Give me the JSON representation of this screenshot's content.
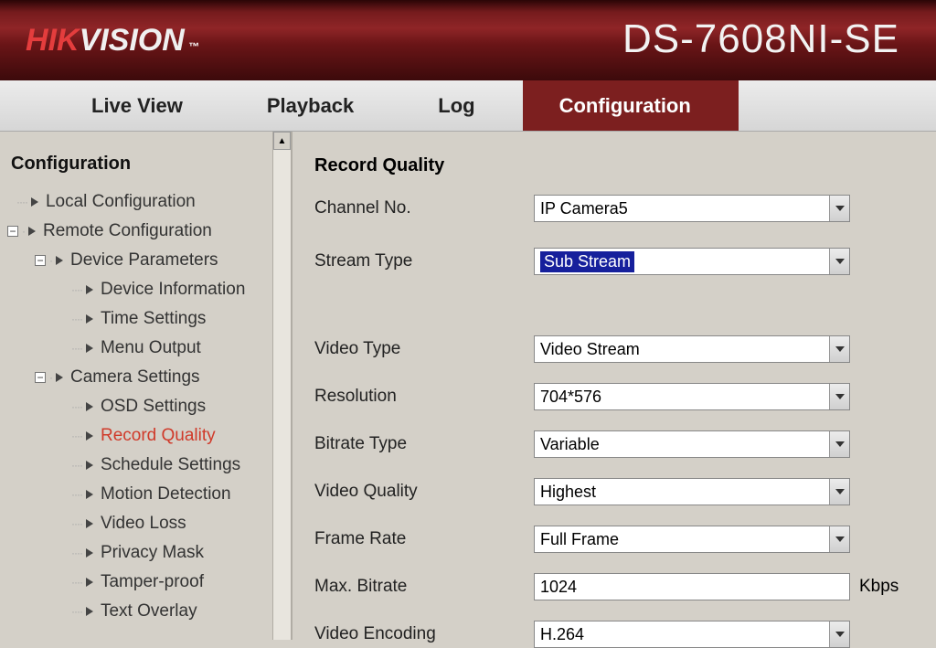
{
  "brand": {
    "hik": "HIK",
    "vision": "VISION",
    "tm": "™"
  },
  "model": "DS-7608NI-SE",
  "tabs": {
    "live_view": "Live View",
    "playback": "Playback",
    "log": "Log",
    "configuration": "Configuration"
  },
  "sidebar": {
    "title": "Configuration",
    "local_config": "Local Configuration",
    "remote_config": "Remote Configuration",
    "device_params": "Device Parameters",
    "device_info": "Device Information",
    "time_settings": "Time Settings",
    "menu_output": "Menu Output",
    "camera_settings": "Camera Settings",
    "osd_settings": "OSD Settings",
    "record_quality": "Record Quality",
    "schedule_settings": "Schedule Settings",
    "motion_detection": "Motion Detection",
    "video_loss": "Video Loss",
    "privacy_mask": "Privacy Mask",
    "tamper_proof": "Tamper-proof",
    "text_overlay": "Text Overlay"
  },
  "form": {
    "section": "Record Quality",
    "channel_no_label": "Channel No.",
    "channel_no_value": "IP Camera5",
    "stream_type_label": "Stream Type",
    "stream_type_value": "Sub Stream",
    "video_type_label": "Video Type",
    "video_type_value": "Video Stream",
    "resolution_label": "Resolution",
    "resolution_value": "704*576",
    "bitrate_type_label": "Bitrate Type",
    "bitrate_type_value": "Variable",
    "video_quality_label": "Video Quality",
    "video_quality_value": "Highest",
    "frame_rate_label": "Frame Rate",
    "frame_rate_value": "Full Frame",
    "max_bitrate_label": "Max. Bitrate",
    "max_bitrate_value": "1024",
    "max_bitrate_unit": "Kbps",
    "video_encoding_label": "Video Encoding",
    "video_encoding_value": "H.264"
  }
}
